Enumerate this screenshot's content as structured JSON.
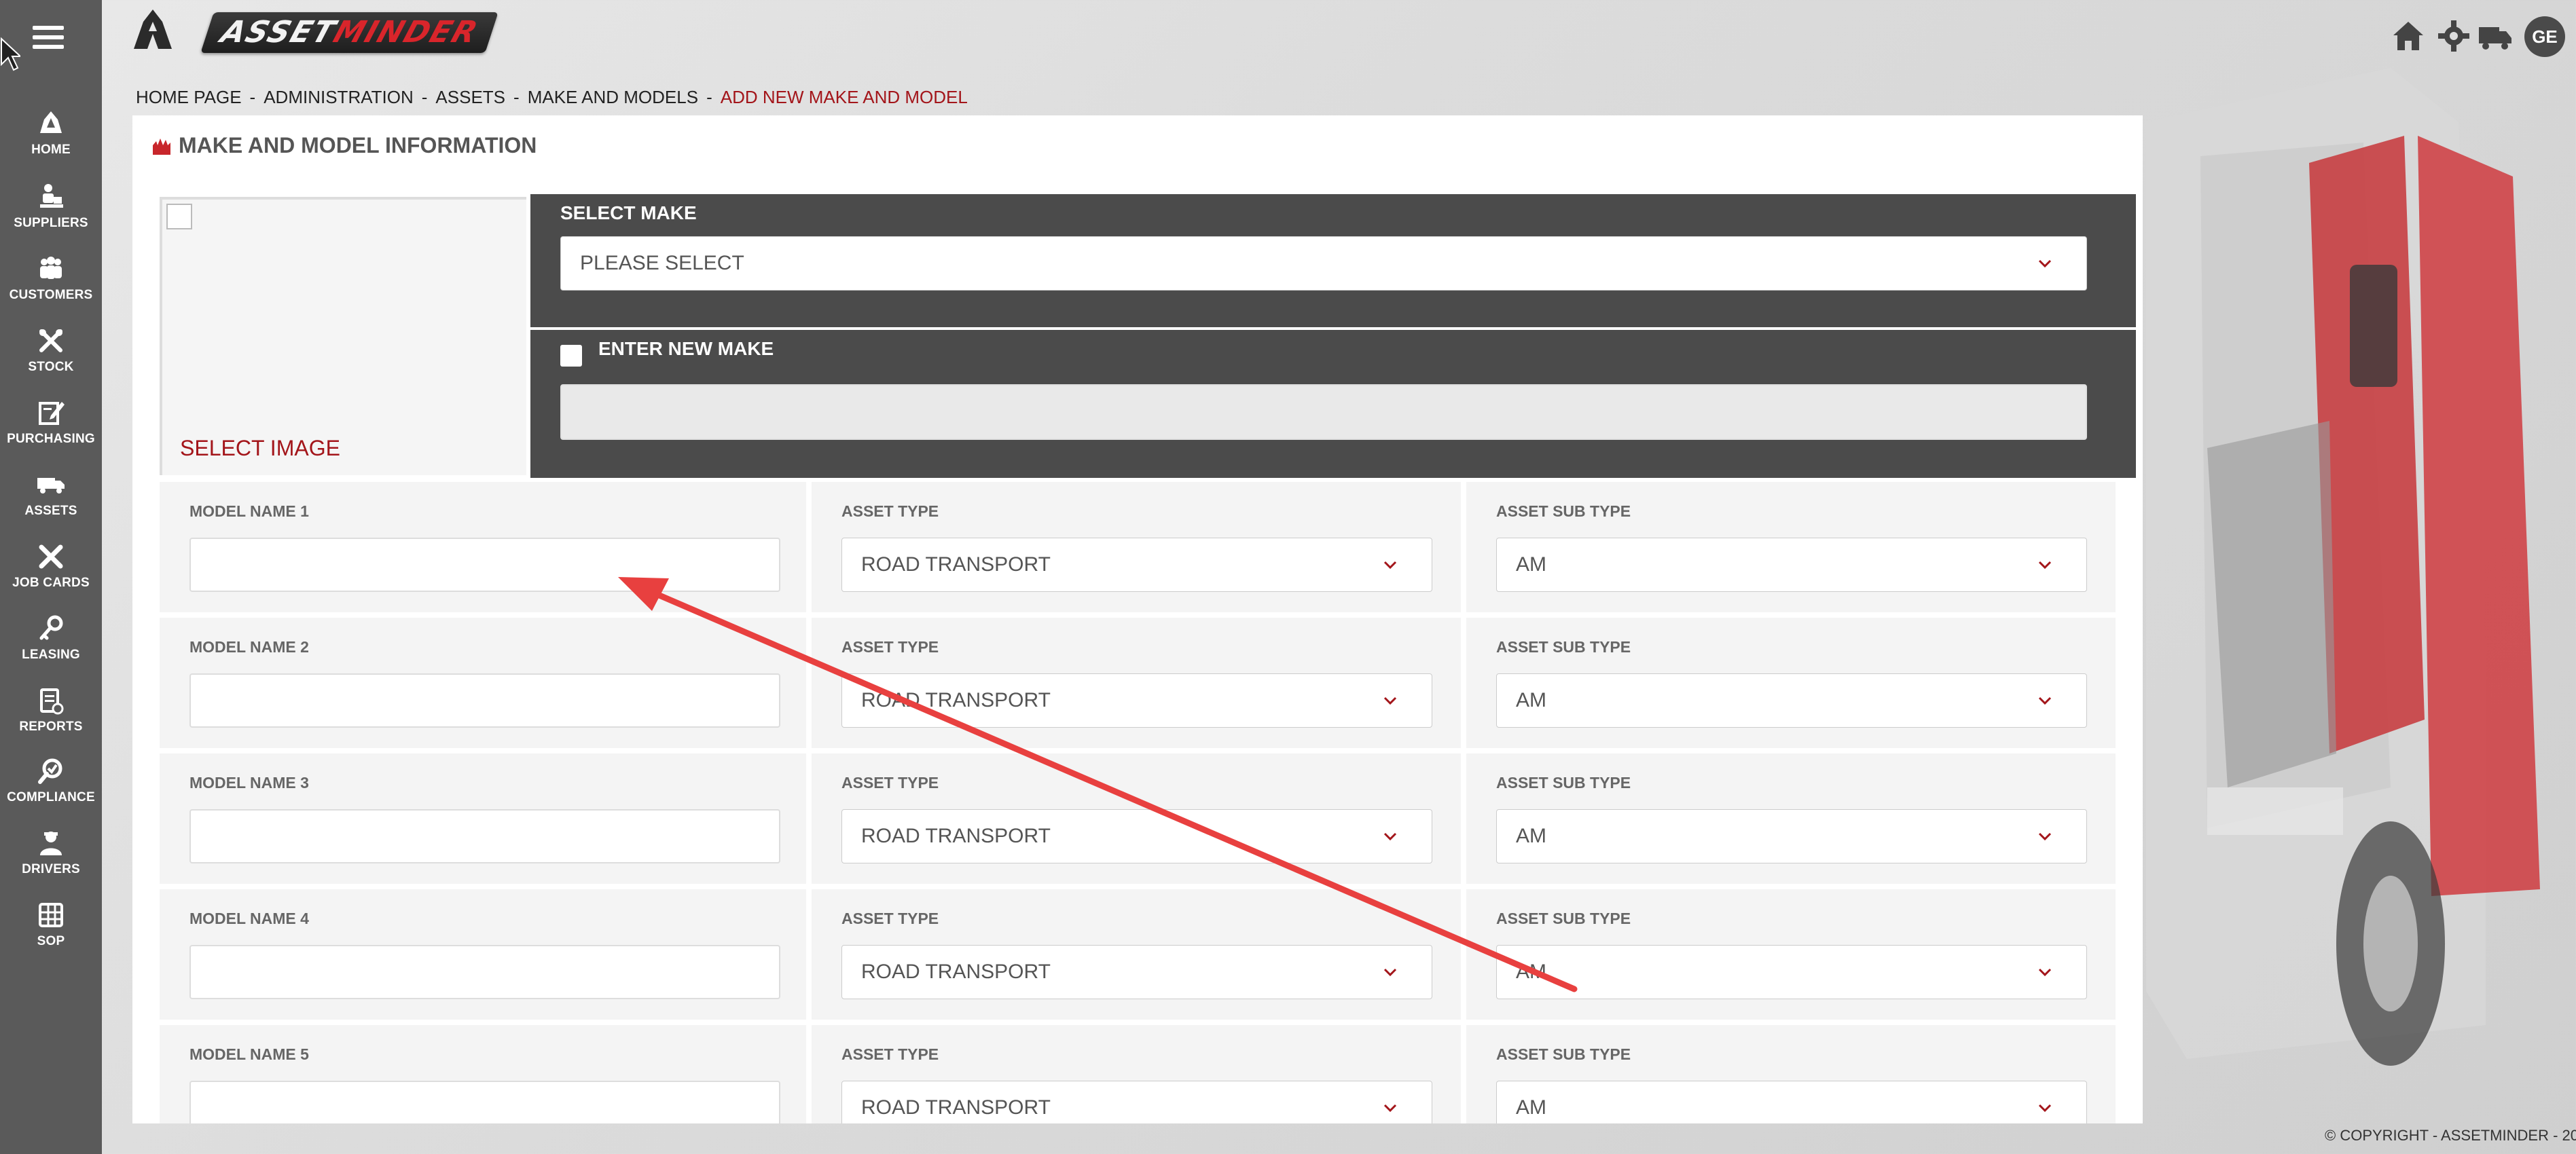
{
  "app": {
    "logo_text_part1": "ASSET",
    "logo_text_part2": "MINDER",
    "user_initials": "GE",
    "copyright": "© COPYRIGHT - ASSETMINDER - 20"
  },
  "sidebar": {
    "items": [
      {
        "label": "HOME",
        "icon": "home-icon"
      },
      {
        "label": "SUPPLIERS",
        "icon": "suppliers-icon"
      },
      {
        "label": "CUSTOMERS",
        "icon": "customers-icon"
      },
      {
        "label": "STOCK",
        "icon": "stock-icon"
      },
      {
        "label": "PURCHASING",
        "icon": "purchasing-icon"
      },
      {
        "label": "ASSETS",
        "icon": "truck-icon"
      },
      {
        "label": "JOB CARDS",
        "icon": "job-cards-icon"
      },
      {
        "label": "LEASING",
        "icon": "leasing-icon"
      },
      {
        "label": "REPORTS",
        "icon": "reports-icon"
      },
      {
        "label": "COMPLIANCE",
        "icon": "compliance-icon"
      },
      {
        "label": "DRIVERS",
        "icon": "drivers-icon"
      },
      {
        "label": "SOP",
        "icon": "sop-icon"
      }
    ]
  },
  "breadcrumb": {
    "items": [
      "HOME PAGE",
      "ADMINISTRATION",
      "ASSETS",
      "MAKE AND MODELS"
    ],
    "current": "ADD NEW MAKE AND MODEL",
    "separator": "-"
  },
  "panel": {
    "title": "MAKE AND MODEL INFORMATION",
    "select_image": "SELECT IMAGE",
    "select_make_label": "SELECT MAKE",
    "select_make_value": "PLEASE SELECT",
    "enter_new_make_label": "ENTER NEW MAKE",
    "enter_new_make_value": ""
  },
  "models": [
    {
      "name_label": "MODEL NAME 1",
      "name_value": "",
      "type_label": "ASSET TYPE",
      "type_value": "ROAD TRANSPORT",
      "subtype_label": "ASSET SUB TYPE",
      "subtype_value": "AM"
    },
    {
      "name_label": "MODEL NAME 2",
      "name_value": "",
      "type_label": "ASSET TYPE",
      "type_value": "ROAD TRANSPORT",
      "subtype_label": "ASSET SUB TYPE",
      "subtype_value": "AM"
    },
    {
      "name_label": "MODEL NAME 3",
      "name_value": "",
      "type_label": "ASSET TYPE",
      "type_value": "ROAD TRANSPORT",
      "subtype_label": "ASSET SUB TYPE",
      "subtype_value": "AM"
    },
    {
      "name_label": "MODEL NAME 4",
      "name_value": "",
      "type_label": "ASSET TYPE",
      "type_value": "ROAD TRANSPORT",
      "subtype_label": "ASSET SUB TYPE",
      "subtype_value": "AM"
    },
    {
      "name_label": "MODEL NAME 5",
      "name_value": "",
      "type_label": "ASSET TYPE",
      "type_value": "ROAD TRANSPORT",
      "subtype_label": "ASSET SUB TYPE",
      "subtype_value": "AM"
    }
  ],
  "colors": {
    "sidebar_bg": "#5a5a5a",
    "accent_red": "#a3151a",
    "dark_block": "#4b4b4b",
    "annotation_arrow": "#e8403f"
  }
}
